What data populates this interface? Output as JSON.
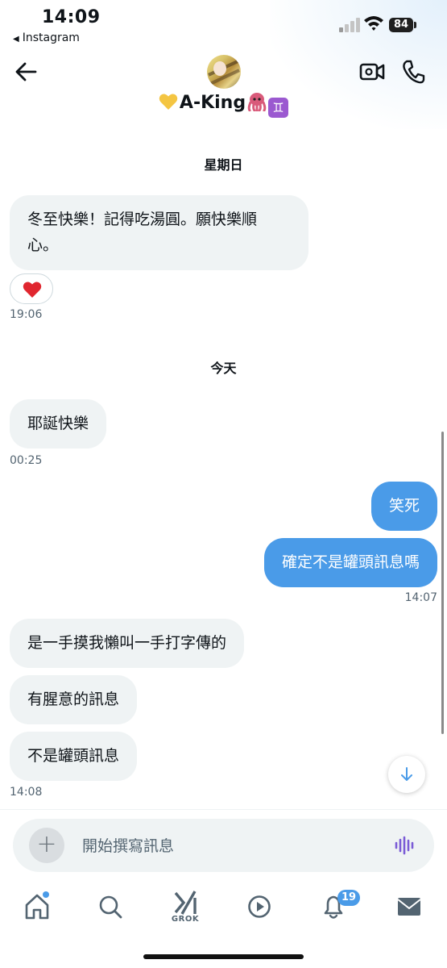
{
  "status_bar": {
    "time": "14:09",
    "back_app": "Instagram",
    "battery": "84"
  },
  "header": {
    "contact_name": "A-King",
    "icons": [
      "back-arrow-icon",
      "video-call-icon",
      "phone-call-icon"
    ]
  },
  "conversation": {
    "day1_label": "星期日",
    "msg1_line1": "冬至快樂！記得吃湯圓。願快樂順",
    "msg1_line2": "心。",
    "reaction": "heart",
    "time1": "19:06",
    "day2_label": "今天",
    "msg2": "耶誕快樂",
    "time2": "00:25",
    "msg3": "笑死",
    "msg4": "確定不是罐頭訊息嗎",
    "time3": "14:07",
    "msg5": "是一手摸我懶叫一手打字傳的",
    "msg6": "有腥意的訊息",
    "msg7": "不是罐頭訊息",
    "time4": "14:08"
  },
  "composer": {
    "placeholder": "開始撰寫訊息"
  },
  "tab_bar": {
    "grok_label": "GROK",
    "notifications_count": "19"
  },
  "colors": {
    "accent": "#4a9be8",
    "incoming_bubble": "#eff3f4",
    "voice_icon": "#7b5cd6"
  }
}
